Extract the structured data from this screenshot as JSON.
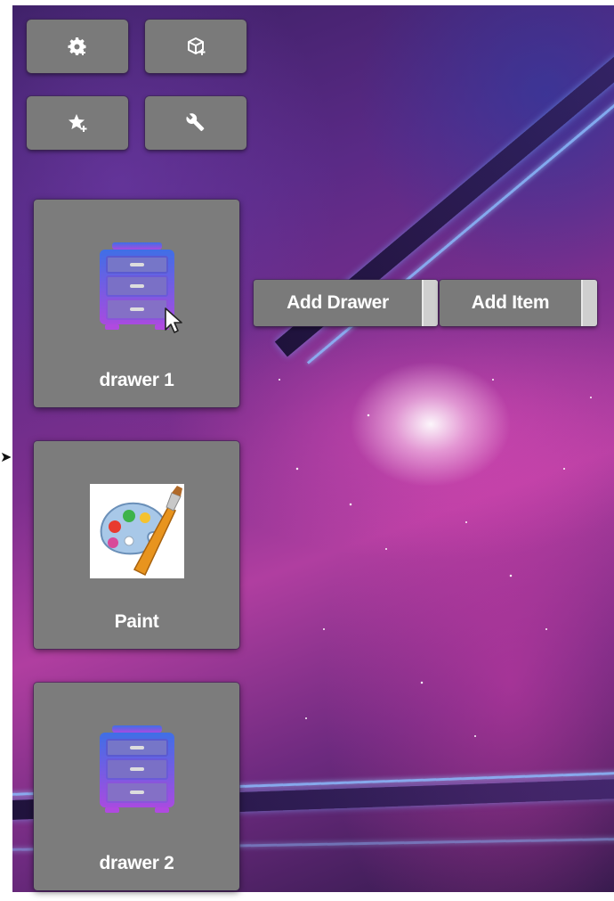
{
  "toolbar": {
    "buttons": [
      {
        "name": "add-settings-button",
        "icon": "gear-plus-icon"
      },
      {
        "name": "add-package-button",
        "icon": "box-plus-icon"
      },
      {
        "name": "add-favorite-button",
        "icon": "star-plus-icon"
      },
      {
        "name": "tools-button",
        "icon": "wrench-icon"
      }
    ]
  },
  "tiles": [
    {
      "label": "drawer 1",
      "icon": "drawer-icon"
    },
    {
      "label": "Paint",
      "icon": "paint-palette-icon"
    },
    {
      "label": "drawer 2",
      "icon": "drawer-icon"
    }
  ],
  "context_menu": {
    "add_drawer_label": "Add Drawer",
    "add_item_label": "Add Item"
  },
  "colors": {
    "button_gray": "#7a7a7a",
    "drawer_blue": "#4a6fe0",
    "drawer_purple": "#a64ae0"
  }
}
